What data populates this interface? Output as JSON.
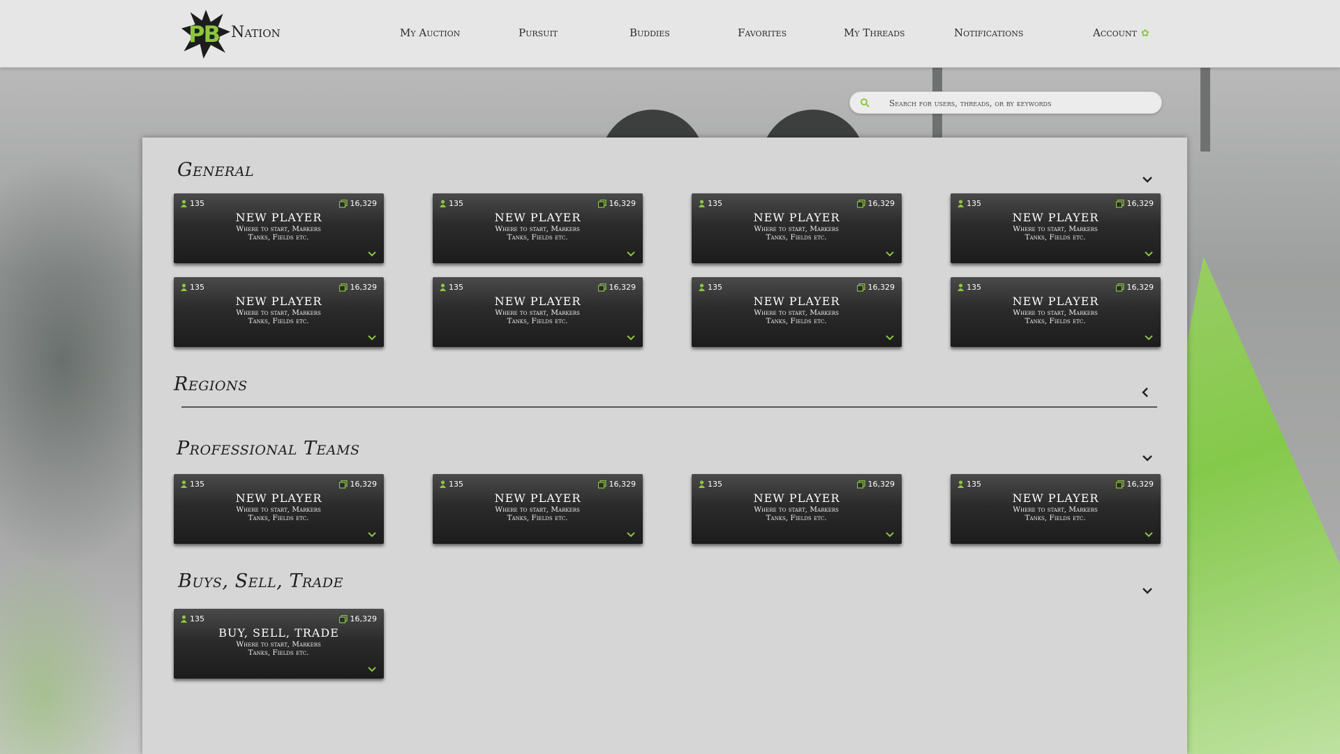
{
  "brand": {
    "logo_mark": "PB",
    "logo_word": "Nation"
  },
  "nav": [
    {
      "label": "My Auction"
    },
    {
      "label": "Pursuit"
    },
    {
      "label": "Buddies"
    },
    {
      "label": "Favorites"
    },
    {
      "label": "My Threads"
    },
    {
      "label": "Notifications"
    },
    {
      "label": "Account"
    }
  ],
  "search": {
    "placeholder": "Search for users, threads, or by keywords"
  },
  "colors": {
    "accent": "#8cc63f",
    "card_dark": "#1c1c1c",
    "panel": "#d6d6d6"
  },
  "sections": {
    "general": {
      "title": "General",
      "toggle_icon": "chevron-down-icon",
      "cards": [
        {
          "users": "135",
          "posts": "16,329",
          "title": "NEW PLAYER",
          "desc_line1": "Where to start, Markers",
          "desc_line2": "Tanks, Fields etc."
        },
        {
          "users": "135",
          "posts": "16,329",
          "title": "NEW PLAYER",
          "desc_line1": "Where to start, Markers",
          "desc_line2": "Tanks, Fields etc."
        },
        {
          "users": "135",
          "posts": "16,329",
          "title": "NEW PLAYER",
          "desc_line1": "Where to start, Markers",
          "desc_line2": "Tanks, Fields etc."
        },
        {
          "users": "135",
          "posts": "16,329",
          "title": "NEW PLAYER",
          "desc_line1": "Where to start, Markers",
          "desc_line2": "Tanks, Fields etc."
        },
        {
          "users": "135",
          "posts": "16,329",
          "title": "NEW PLAYER",
          "desc_line1": "Where to start, Markers",
          "desc_line2": "Tanks, Fields etc."
        },
        {
          "users": "135",
          "posts": "16,329",
          "title": "NEW PLAYER",
          "desc_line1": "Where to start, Markers",
          "desc_line2": "Tanks, Fields etc."
        },
        {
          "users": "135",
          "posts": "16,329",
          "title": "NEW PLAYER",
          "desc_line1": "Where to start, Markers",
          "desc_line2": "Tanks, Fields etc."
        },
        {
          "users": "135",
          "posts": "16,329",
          "title": "NEW PLAYER",
          "desc_line1": "Where to start, Markers",
          "desc_line2": "Tanks, Fields etc."
        }
      ]
    },
    "regions": {
      "title": "Regions",
      "toggle_icon": "chevron-left-icon"
    },
    "pro_teams": {
      "title": "Professional Teams",
      "toggle_icon": "chevron-down-icon",
      "cards": [
        {
          "users": "135",
          "posts": "16,329",
          "title": "NEW PLAYER",
          "desc_line1": "Where to start, Markers",
          "desc_line2": "Tanks, Fields etc."
        },
        {
          "users": "135",
          "posts": "16,329",
          "title": "NEW PLAYER",
          "desc_line1": "Where to start, Markers",
          "desc_line2": "Tanks, Fields etc."
        },
        {
          "users": "135",
          "posts": "16,329",
          "title": "NEW PLAYER",
          "desc_line1": "Where to start, Markers",
          "desc_line2": "Tanks, Fields etc."
        },
        {
          "users": "135",
          "posts": "16,329",
          "title": "NEW PLAYER",
          "desc_line1": "Where to start, Markers",
          "desc_line2": "Tanks, Fields etc."
        }
      ]
    },
    "bst": {
      "title": "Buys, Sell, Trade",
      "toggle_icon": "chevron-down-icon",
      "cards": [
        {
          "users": "135",
          "posts": "16,329",
          "title": "BUY, SELL, TRADE",
          "desc_line1": "Where to start, Markers",
          "desc_line2": "Tanks, Fields etc."
        }
      ]
    }
  }
}
